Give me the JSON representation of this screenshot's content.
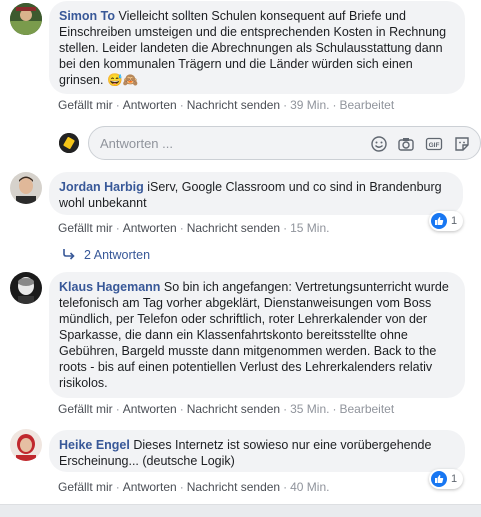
{
  "comments": [
    {
      "author": "Simon To",
      "text": "Vielleicht sollten Schulen konsequent auf Briefe und Einschreiben umsteigen und die entsprechenden Kosten in Rechnung stellen. Leider landeten die Abrechnungen als Schulausstattung dann bei den kommunalen Trägern und die Länder würden sich einen grinsen. 😅🙈",
      "like": "Gefällt mir",
      "reply": "Antworten",
      "message": "Nachricht senden",
      "time": "39 Min.",
      "edit": "Bearbeitet"
    },
    {
      "author": "Jordan Harbig",
      "text": "iServ, Google Classroom und co sind in Brandenburg wohl unbekannt",
      "like": "Gefällt mir",
      "reply": "Antworten",
      "message": "Nachricht senden",
      "time": "15 Min.",
      "reaction_count": "1",
      "replies_label": "2 Antworten"
    },
    {
      "author": "Klaus Hagemann",
      "text": "So bin ich angefangen: Vertretungsunterricht wurde telefonisch am Tag vorher abgeklärt, Dienstanweisungen vom Boss mündlich, per Telefon oder schriftlich, roter Lehrerkalender von der Sparkasse, die dann ein Klassenfahrtskonto bereitsstellte ohne Gebühren, Bargeld musste dann mitgenommen werden. Back to the roots - bis auf einen potentiellen Verlust des Lehrerkalenders relativ risikolos.",
      "like": "Gefällt mir",
      "reply": "Antworten",
      "message": "Nachricht senden",
      "time": "35 Min.",
      "edit": "Bearbeitet"
    },
    {
      "author": "Heike Engel",
      "text": "Dieses Internetz ist sowieso nur eine vorübergehende Erscheinung... (deutsche Logik)",
      "like": "Gefällt mir",
      "reply": "Antworten",
      "message": "Nachricht senden",
      "time": "40 Min.",
      "reaction_count": "1"
    }
  ],
  "reply_box": {
    "placeholder": "Antworten ..."
  },
  "colors": {
    "author": "#385898",
    "like_blue": "#1877f2",
    "bubble": "#f2f3f5"
  }
}
